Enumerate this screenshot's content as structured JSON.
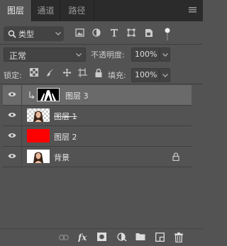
{
  "tabs": [
    {
      "label": "图层",
      "active": true
    },
    {
      "label": "通道",
      "active": false
    },
    {
      "label": "路径",
      "active": false
    }
  ],
  "filter": {
    "kind_label": "类型",
    "icons": [
      "image-filter-icon",
      "adjustment-filter-icon",
      "type-filter-icon",
      "shape-filter-icon",
      "smart-object-filter-icon"
    ]
  },
  "blend_mode": "正常",
  "opacity": {
    "label": "不透明度:",
    "value": "100%"
  },
  "lock": {
    "label": "锁定:",
    "icons": [
      "lock-transparent-pixels-icon",
      "lock-image-pixels-icon",
      "lock-position-icon",
      "lock-artboard-icon",
      "lock-all-icon"
    ]
  },
  "fill": {
    "label": "填充:",
    "value": "100%"
  },
  "layers": [
    {
      "name": "图层 3",
      "selected": true,
      "visible": true,
      "clipped": true,
      "thumb": "mask",
      "locked": false
    },
    {
      "name": "图层 1",
      "selected": false,
      "visible": true,
      "clipped": false,
      "thumb": "photo-transparent",
      "locked": false,
      "strikethrough": true
    },
    {
      "name": "图层 2",
      "selected": false,
      "visible": true,
      "clipped": false,
      "thumb": "red",
      "locked": false
    },
    {
      "name": "背景",
      "selected": false,
      "visible": true,
      "clipped": false,
      "thumb": "photo",
      "locked": true
    }
  ],
  "colors": {
    "panel": "#535353",
    "tabbar": "#2b2b2b",
    "selected_row": "#6a6a6a",
    "red_fill": "#ff0000"
  },
  "bottom_icons": [
    "link-layers-icon",
    "layer-style-fx-icon",
    "add-mask-icon",
    "adjustment-layer-icon",
    "new-group-icon",
    "new-layer-icon",
    "delete-layer-icon"
  ]
}
